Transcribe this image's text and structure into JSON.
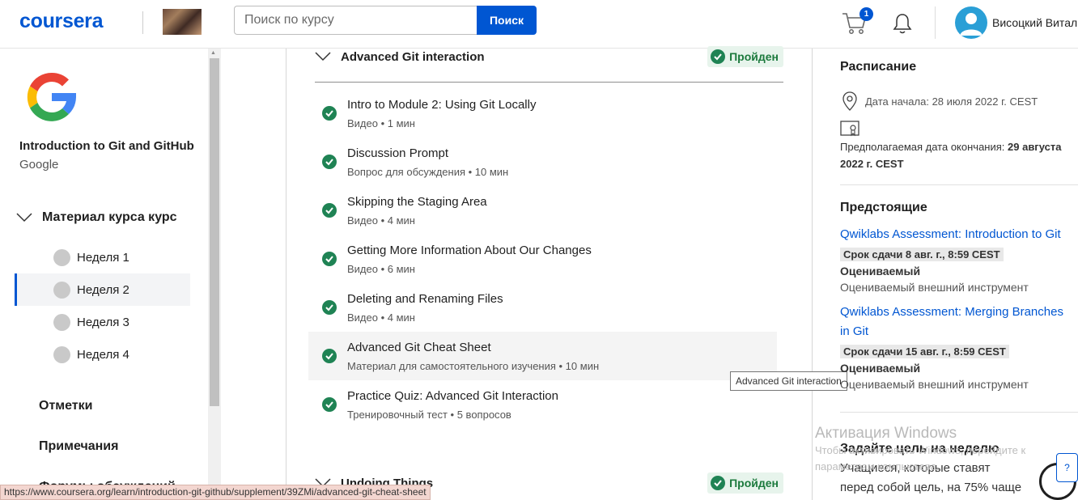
{
  "header": {
    "logo": "coursera",
    "search_placeholder": "Поиск по курсу",
    "search_button": "Поиск",
    "cart_count": "1",
    "user_name": "Висоцкий Витал..."
  },
  "sidebar": {
    "course_title": "Introduction to Git and GitHub",
    "course_partner": "Google",
    "materials_label": "Материал курса курс",
    "weeks": [
      "Неделя 1",
      "Неделя 2",
      "Неделя 3",
      "Неделя 4"
    ],
    "active_week": "Неделя 2",
    "links": [
      "Отметки",
      "Примечания",
      "Форумы обсуждений"
    ]
  },
  "main": {
    "section1": {
      "title": "Advanced Git interaction",
      "status": "Пройден"
    },
    "items": [
      {
        "title": "Intro to Module 2: Using Git Locally",
        "meta": "Видео • 1 мин"
      },
      {
        "title": "Discussion Prompt",
        "meta": "Вопрос для обсуждения • 10 мин"
      },
      {
        "title": "Skipping the Staging Area",
        "meta": "Видео • 4 мин"
      },
      {
        "title": "Getting More Information About Our Changes",
        "meta": "Видео • 6 мин"
      },
      {
        "title": "Deleting and Renaming Files",
        "meta": "Видео • 4 мин"
      },
      {
        "title": "Advanced Git Cheat Sheet",
        "meta": "Материал для самостоятельного изучения • 10 мин"
      },
      {
        "title": "Practice Quiz: Advanced Git Interaction",
        "meta": "Тренировочный тест • 5 вопросов"
      }
    ],
    "section2": {
      "title": "Undoing Things",
      "status": "Пройден"
    },
    "tooltip": "Advanced Git interaction"
  },
  "right": {
    "schedule_title": "Расписание",
    "start_date": "Дата начала: 28 июля 2022 г. CEST",
    "end_label": "Предполагаемая дата окончания:",
    "end_date_a": "29 августа",
    "end_date_b": "2022 г. CEST",
    "upcoming_title": "Предстоящие",
    "upcoming": [
      {
        "title": "Qwiklabs Assessment: Introduction to Git",
        "due": "Срок сдачи 8 авг. г., 8:59 CEST",
        "graded": "Оцениваемый",
        "type": "Оцениваемый внешний инструмент"
      },
      {
        "title": "Qwiklabs Assessment: Merging Branches in Git",
        "due": "Срок сдачи 15 авг. г., 8:59 CEST",
        "graded": "Оцениваемый",
        "type": "Оцениваемый внешний инструмент"
      }
    ],
    "goal_title": "Задайте цель на неделю",
    "goal_line1": "Учащиеся, которые ставят",
    "goal_line2": "перед собой цель, на 75% чаще"
  },
  "overlay": {
    "activate_title": "Активация Windows",
    "activate_sub": "Чтобы активировать Windows, перейдите к",
    "activate_sub2": "параметрам компьютера.",
    "status_url": "https://www.coursera.org/learn/introduction-git-github/supplement/39ZMi/advanced-git-cheat-sheet"
  },
  "colors": {
    "brand": "#0056d2",
    "success": "#1f8354",
    "passed_bg": "#e7f4ec"
  }
}
